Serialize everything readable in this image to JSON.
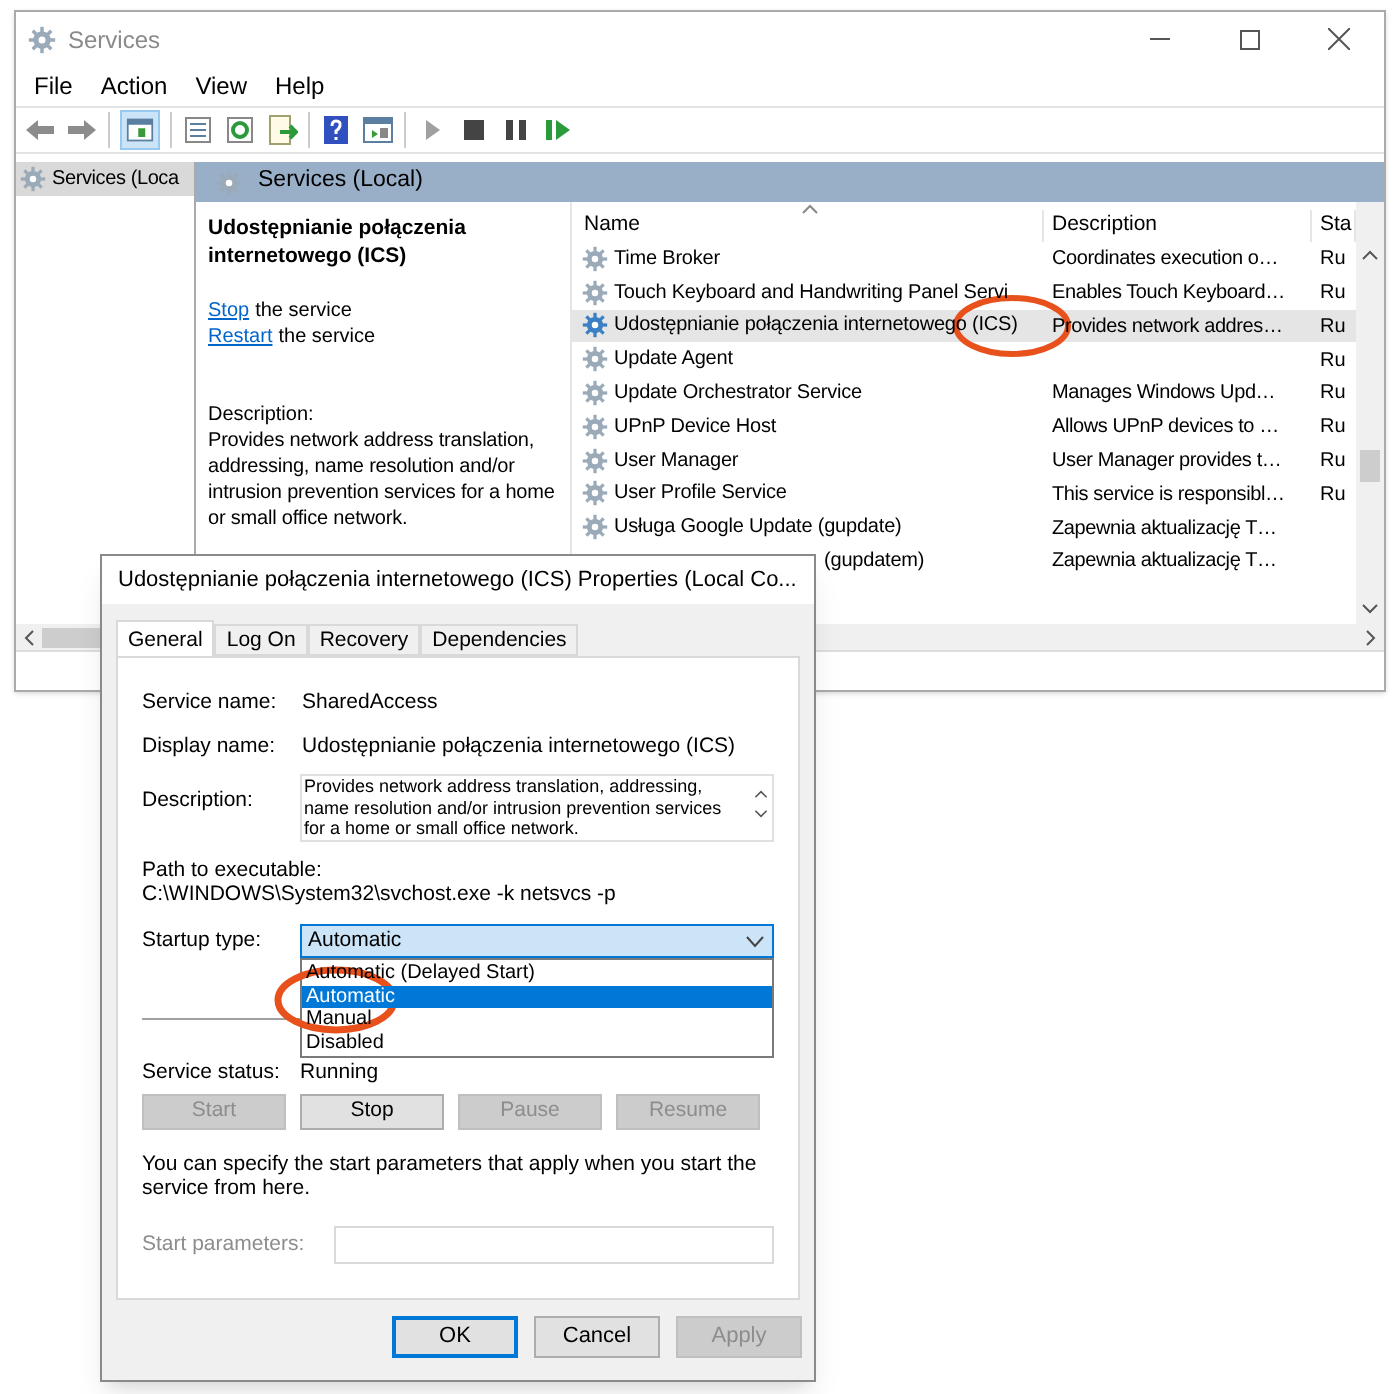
{
  "main_window": {
    "title": "Services",
    "menu": [
      "File",
      "Action",
      "View",
      "Help"
    ],
    "tree": [
      {
        "label": "Services (Loca",
        "selected": true
      }
    ],
    "panel_header": "Services (Local)",
    "details": {
      "title": "Udostępnianie połączenia internetowego (ICS)",
      "actions": [
        {
          "link": "Stop",
          "text": "the service"
        },
        {
          "link": "Restart",
          "text": "the service"
        }
      ],
      "description_label": "Description:",
      "description": "Provides network address translation, addressing, name resolution and/or intrusion prevention services for a home or small office network."
    },
    "table": {
      "columns": [
        "Name",
        "Description",
        "Sta"
      ],
      "rows": [
        {
          "name": "Time Broker",
          "description": "Coordinates execution o…",
          "status": "Ru",
          "selected": false
        },
        {
          "name": "Touch Keyboard and Handwriting Panel Servi",
          "description": "Enables Touch Keyboard…",
          "status": "Ru",
          "selected": false
        },
        {
          "name": "Udostępnianie połączenia internetowego (ICS)",
          "description": "Provides network addres…",
          "status": "Ru",
          "selected": true
        },
        {
          "name": "Update Agent",
          "description": "",
          "status": "Ru",
          "selected": false
        },
        {
          "name": "Update Orchestrator Service",
          "description": "Manages Windows Upd…",
          "status": "Ru",
          "selected": false
        },
        {
          "name": "UPnP Device Host",
          "description": "Allows UPnP devices to …",
          "status": "Ru",
          "selected": false
        },
        {
          "name": "User Manager",
          "description": "User Manager provides t…",
          "status": "Ru",
          "selected": false
        },
        {
          "name": "User Profile Service",
          "description": "This service is responsibl…",
          "status": "Ru",
          "selected": false
        },
        {
          "name": "Usługa Google Update (gupdate)",
          "description": "Zapewnia aktualizację T…",
          "status": "",
          "selected": false
        },
        {
          "name": "(gupdatem)",
          "description": "Zapewnia aktualizację T…",
          "status": "",
          "selected": false,
          "partly_hidden": true
        }
      ]
    }
  },
  "dialog": {
    "title": "Udostępnianie połączenia internetowego (ICS) Properties (Local Co...",
    "tabs": [
      {
        "label": "General",
        "selected": true
      },
      {
        "label": "Log On",
        "selected": false
      },
      {
        "label": "Recovery",
        "selected": false
      },
      {
        "label": "Dependencies",
        "selected": false
      }
    ],
    "service_name": {
      "label": "Service name:",
      "value": "SharedAccess"
    },
    "display_name": {
      "label": "Display name:",
      "value": "Udostępnianie połączenia internetowego (ICS)"
    },
    "description": {
      "label": "Description:",
      "value": "Provides network address translation, addressing, name resolution and/or intrusion prevention services for a home or small office network."
    },
    "path": {
      "label": "Path to executable:",
      "value": "C:\\WINDOWS\\System32\\svchost.exe -k netsvcs -p"
    },
    "startup_type": {
      "label": "Startup type:",
      "value": "Automatic",
      "options": [
        {
          "label": "Automatic (Delayed Start)",
          "selected": false
        },
        {
          "label": "Automatic",
          "selected": true
        },
        {
          "label": "Manual",
          "selected": false
        },
        {
          "label": "Disabled",
          "selected": false
        }
      ]
    },
    "service_status": {
      "label": "Service status:",
      "value": "Running"
    },
    "service_buttons": [
      {
        "label": "Start",
        "disabled": true
      },
      {
        "label": "Stop",
        "disabled": false
      },
      {
        "label": "Pause",
        "disabled": true
      },
      {
        "label": "Resume",
        "disabled": true
      }
    ],
    "hint": "You can specify the start parameters that apply when you start the service from here.",
    "start_parameters": {
      "label": "Start parameters:",
      "disabled": true
    },
    "buttons": [
      {
        "label": "OK",
        "disabled": false,
        "default": true
      },
      {
        "label": "Cancel",
        "disabled": false,
        "default": false
      },
      {
        "label": "Apply",
        "disabled": true,
        "default": false
      }
    ]
  }
}
